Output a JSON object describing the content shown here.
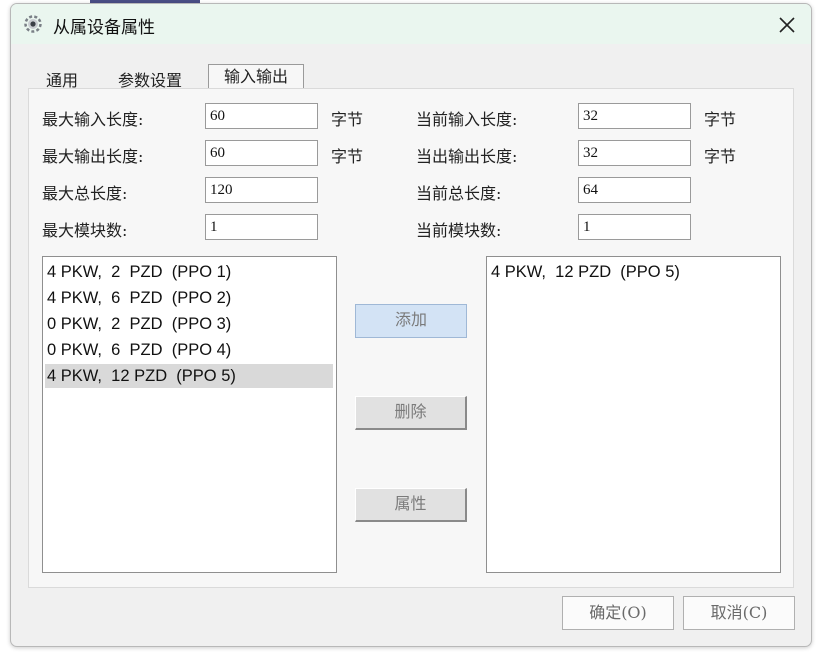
{
  "window": {
    "title": "从属设备属性",
    "app_icon": "gear-icon",
    "close_icon": "close-icon"
  },
  "tabs": [
    {
      "label": "通用",
      "active": false
    },
    {
      "label": "参数设置",
      "active": false
    },
    {
      "label": "输入输出",
      "active": true
    }
  ],
  "form": {
    "max_input_len": {
      "label": "最大输入长度:",
      "value": "60",
      "unit": "字节"
    },
    "max_output_len": {
      "label": "最大输出长度:",
      "value": "60",
      "unit": "字节"
    },
    "max_total_len": {
      "label": "最大总长度:",
      "value": "120"
    },
    "max_modules": {
      "label": "最大模块数:",
      "value": "1"
    },
    "cur_input_len": {
      "label": "当前输入长度:",
      "value": "32",
      "unit": "字节"
    },
    "cur_output_len": {
      "label": "当出输出长度:",
      "value": "32",
      "unit": "字节"
    },
    "cur_total_len": {
      "label": "当前总长度:",
      "value": "64"
    },
    "cur_modules": {
      "label": "当前模块数:",
      "value": "1"
    }
  },
  "available_modules": [
    "4 PKW,  2  PZD  (PPO 1)",
    "4 PKW,  6  PZD  (PPO 2)",
    "0 PKW,  2  PZD  (PPO 3)",
    "0 PKW,  6  PZD  (PPO 4)",
    "4 PKW,  12 PZD  (PPO 5)"
  ],
  "selected_available_index": 4,
  "configured_modules": [
    "4 PKW,  12 PZD  (PPO 5)"
  ],
  "actions": {
    "add": "添加",
    "delete": "删除",
    "properties": "属性"
  },
  "footer": {
    "ok": "确定(O)",
    "cancel": "取消(C)"
  },
  "colors": {
    "titlebar": "#eaf6ef",
    "selection": "#d9d9d9",
    "primary_button": "#d3e3f5"
  }
}
